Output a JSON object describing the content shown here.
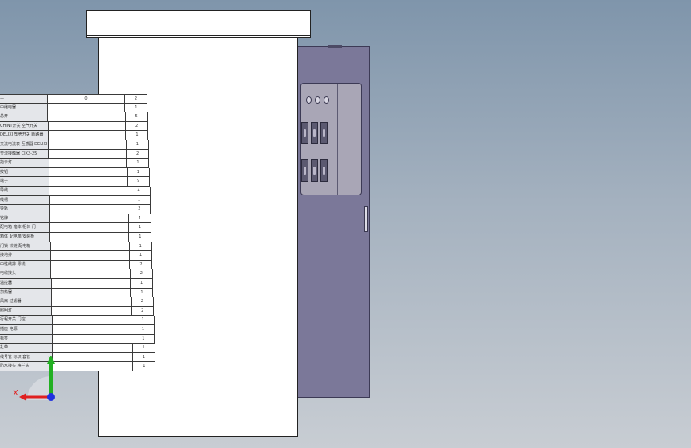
{
  "colors": {
    "background_top": "#7f95ab",
    "background_bottom": "#c8cdd3",
    "cabinet": "#7b7899",
    "sheet": "#ffffff",
    "axis_x": "#e02020",
    "axis_y": "#22b022",
    "axis_z": "#2030e0"
  },
  "triad": {
    "x_label": "X",
    "y_label": "Y"
  },
  "bom": {
    "header": {
      "name": "—",
      "spec": "0",
      "qty": "2"
    },
    "rows": [
      {
        "name": "中继电器",
        "qty": "1"
      },
      {
        "name": "总开",
        "qty": "5"
      },
      {
        "name": "CHINT开关 空气开关",
        "qty": "2"
      },
      {
        "name": "DELIXI 塑壳开关 断路器",
        "qty": "1"
      },
      {
        "name": "交流电流表 互感器 DELIXI",
        "qty": "1"
      },
      {
        "name": "交流接触器 CJX2-25",
        "qty": "2"
      },
      {
        "name": "指示灯",
        "qty": "1"
      },
      {
        "name": "按钮",
        "qty": "1"
      },
      {
        "name": "端子",
        "qty": "9"
      },
      {
        "name": "导线",
        "qty": "4"
      },
      {
        "name": "线槽",
        "qty": "1"
      },
      {
        "name": "导轨",
        "qty": "2"
      },
      {
        "name": "铭牌",
        "qty": "4"
      },
      {
        "name": "配电箱 箱体 柜体 门",
        "qty": "1"
      },
      {
        "name": "箱体 配电箱 安装板",
        "qty": "1"
      },
      {
        "name": "门锁 铰链 配电箱",
        "qty": "1"
      },
      {
        "name": "接地排",
        "qty": "1"
      },
      {
        "name": "中性线排 零线",
        "qty": "2"
      },
      {
        "name": "电缆接头",
        "qty": "2"
      },
      {
        "name": "温控器",
        "qty": "1"
      },
      {
        "name": "加热器",
        "qty": "1"
      },
      {
        "name": "风扇 过滤器",
        "qty": "2"
      },
      {
        "name": "照明灯",
        "qty": "2"
      },
      {
        "name": "行程开关 门控",
        "qty": "1"
      },
      {
        "name": "插座 电源",
        "qty": "1"
      },
      {
        "name": "标签",
        "qty": "1"
      },
      {
        "name": "扎带",
        "qty": "1"
      },
      {
        "name": "线号管 标识 套管",
        "qty": "1"
      },
      {
        "name": "防水接头 格兰头",
        "qty": "1"
      }
    ]
  }
}
